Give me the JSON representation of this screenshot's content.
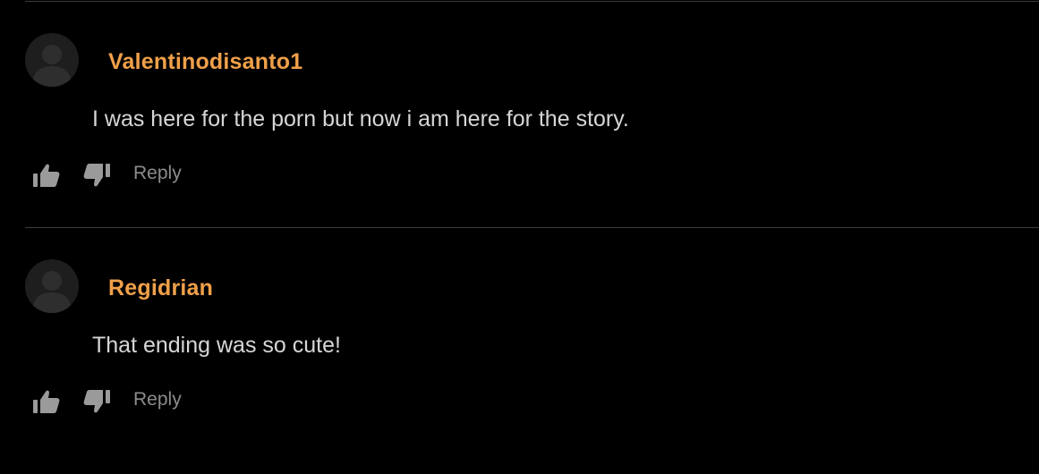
{
  "colors": {
    "background": "#000000",
    "username": "#f0a04a",
    "comment_text": "#d6d6d6",
    "reply_text": "#8c8c8c",
    "icon": "#9a9a9a",
    "divider": "#3a3a3a"
  },
  "icons": {
    "avatar": "default-user-silhouette",
    "like": "thumbs-up",
    "dislike": "thumbs-down"
  },
  "comments": [
    {
      "username": "Valentinodisanto1",
      "text": "I was here for the porn but now i am here for the story.",
      "reply_label": "Reply"
    },
    {
      "username": "Regidrian",
      "text": "That ending was so cute!",
      "reply_label": "Reply"
    }
  ]
}
